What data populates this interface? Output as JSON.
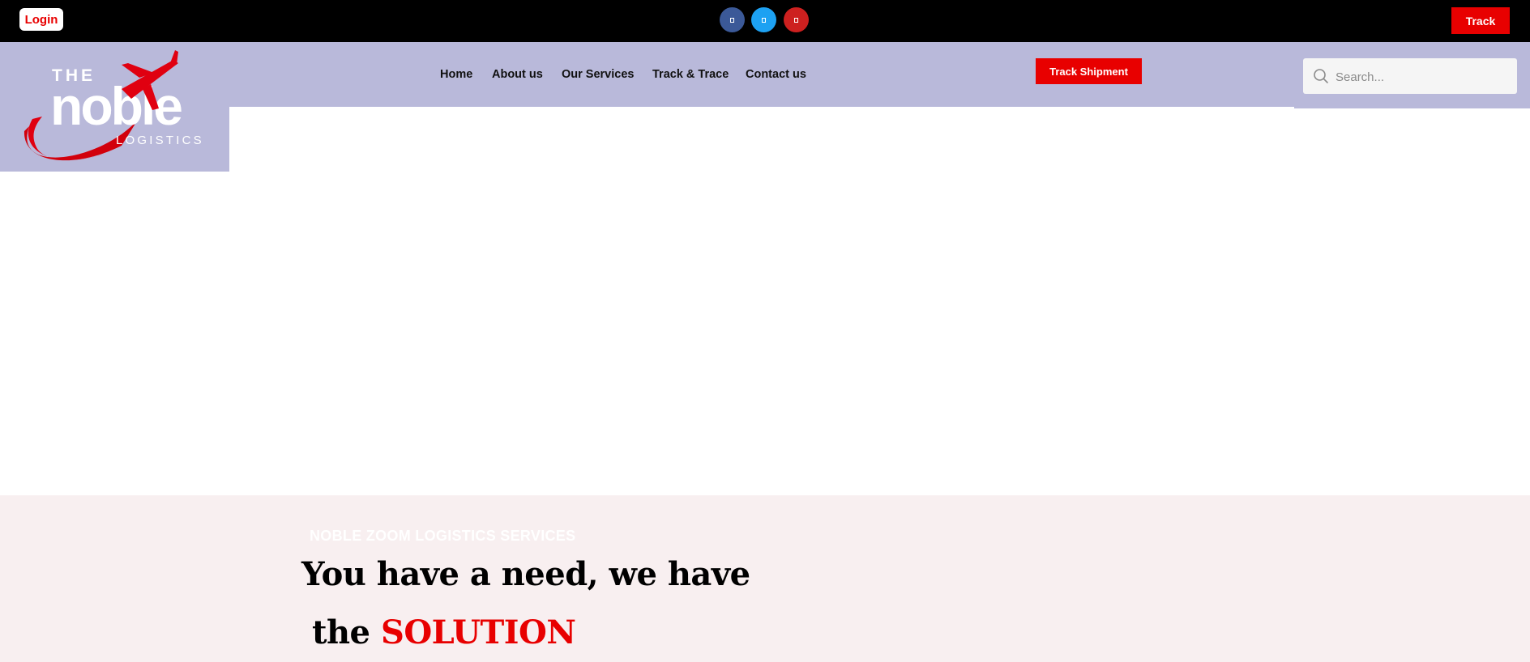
{
  "topbar": {
    "login_label": "Login",
    "track_label": "Track",
    "social": [
      {
        "icon": "facebook-icon",
        "color": "#3b5998"
      },
      {
        "icon": "twitter-icon",
        "color": "#1da1f2"
      },
      {
        "icon": "youtube-icon",
        "color": "#cd201f"
      }
    ]
  },
  "brand": {
    "logo_the": "THE",
    "logo_name": "noble",
    "logo_tagline": "LOGISTICS"
  },
  "nav": {
    "items": [
      "Home",
      "About us",
      "Our Services",
      "Track & Trace",
      "Contact us"
    ]
  },
  "header": {
    "track_shipment_label": "Track Shipment",
    "search_placeholder": "Search..."
  },
  "hero": {
    "eyebrow": "NOBLE ZOOM LOGISTICS SERVICES",
    "headline_line1": "You have a need, we have",
    "headline_line2_prefix": "the",
    "headline_line2_accent": "SOLUTION"
  },
  "colors": {
    "accent_red": "#e80000",
    "header_lavender": "#b9b9da",
    "hero_bg": "#f8eff0",
    "topbar_bg": "#000000"
  }
}
